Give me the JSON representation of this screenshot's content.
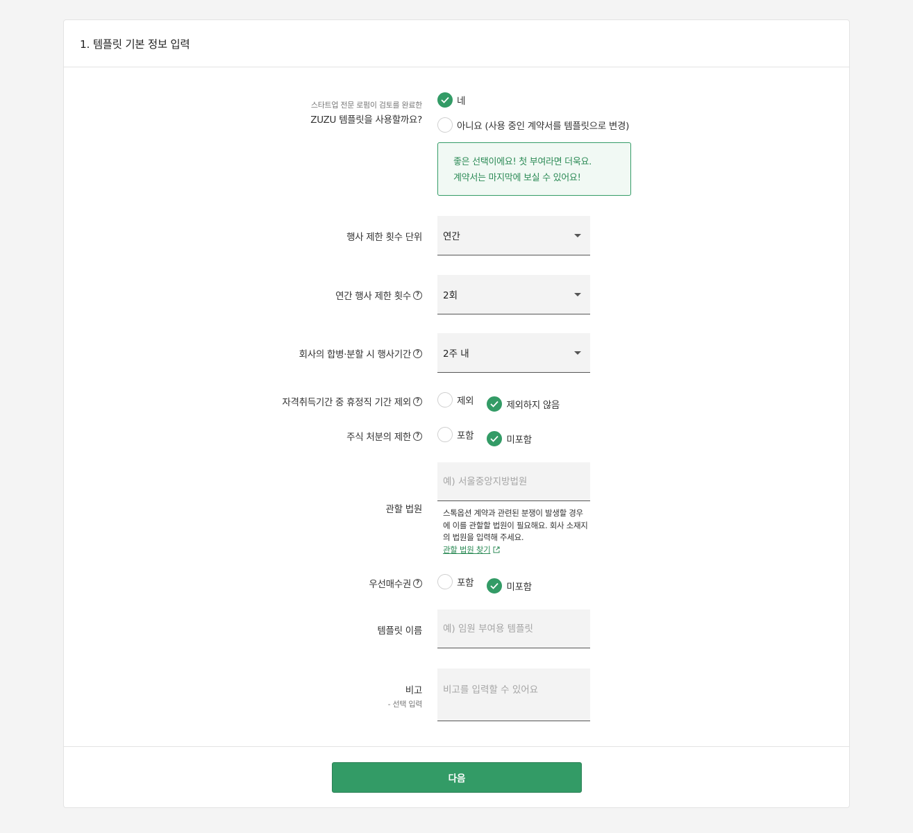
{
  "header": {
    "title": "1. 템플릿 기본 정보 입력"
  },
  "template_use": {
    "sublabel": "스타트업 전문 로펌이 검토를 완료한",
    "label": "ZUZU 템플릿을 사용할까요?",
    "options": [
      "네",
      "아니요 (사용 중인 계약서를 템플릿으로 변경)"
    ],
    "selected": "네",
    "notice_line1": "좋은 선택이에요! 첫 부여라면 더욱요.",
    "notice_line2": "계약서는 마지막에 보실 수 있어요!"
  },
  "exercise_unit": {
    "label": "행사 제한 횟수 단위",
    "value": "연간"
  },
  "exercise_count": {
    "label": "연간 행사 제한 횟수",
    "value": "2회"
  },
  "merger_period": {
    "label": "회사의 합병·분할 시 행사기간",
    "value": "2주 내"
  },
  "leave_exclusion": {
    "label": "자격취득기간 중 휴정직 기간 제외",
    "options": [
      "제외",
      "제외하지 않음"
    ],
    "selected": "제외하지 않음"
  },
  "stock_disposal": {
    "label": "주식 처분의 제한",
    "options": [
      "포함",
      "미포함"
    ],
    "selected": "미포함"
  },
  "court": {
    "label": "관할 법원",
    "placeholder": "예) 서울중앙지방법원",
    "helper": "스톡옵션 계약과 관련된 분쟁이 발생할 경우에 이를 관할할 법원이 필요해요. 회사 소재지의 법원을 입력해 주세요.",
    "link": "관할 법원 찾기"
  },
  "preemption": {
    "label": "우선매수권",
    "options": [
      "포함",
      "미포함"
    ],
    "selected": "미포함"
  },
  "template_name": {
    "label": "템플릿 이름",
    "placeholder": "예) 임원 부여용 템플릿"
  },
  "remarks": {
    "label": "비고",
    "sublabel": "- 선택 입력",
    "placeholder": "비고를 입력할 수 있어요"
  },
  "footer": {
    "next_label": "다음"
  },
  "colors": {
    "accent": "#339b66",
    "notice_bg": "#f1f9f4"
  },
  "icons": {
    "check": "check-icon",
    "help": "help-circle-icon",
    "caret": "caret-down-icon",
    "external": "external-link-icon"
  }
}
